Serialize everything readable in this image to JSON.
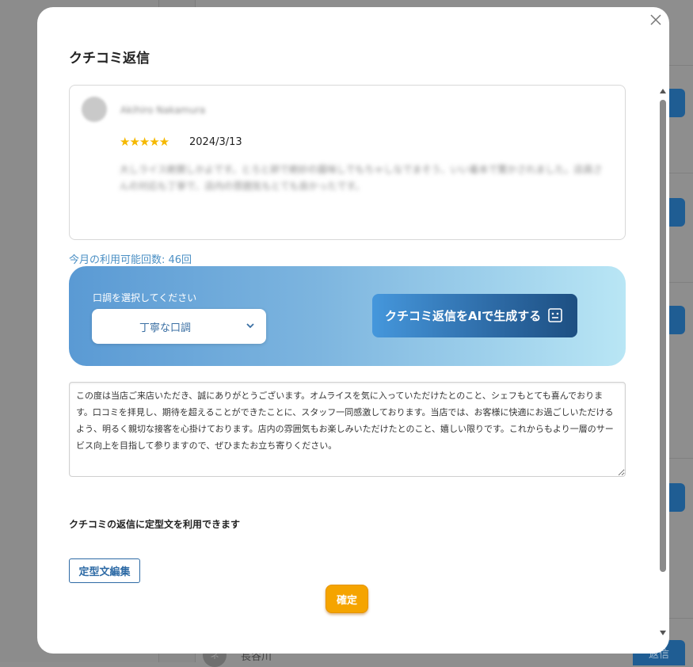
{
  "background": {
    "list_item_name": "長谷川",
    "list_item_avatar": "ネ",
    "reply_button_label": "返信"
  },
  "modal": {
    "title": "クチコミ返信",
    "review": {
      "reviewer_name": "Akihiro Nakamura",
      "stars": "★★★★★",
      "rating": 5,
      "date": "2024/3/13",
      "text": "大しライス絶賛しかよです。とろと卵で絶妙の醤味しでもちゃしなでまそう、いい着本で驚かされました。店員さんの対応も丁寧で、店内の雰囲気もとても良かったです。"
    },
    "usage_text": "今月の利用可能回数: 46回",
    "generator": {
      "tone_label": "口調を選択してください",
      "tone_selected": "丁寧な口調",
      "generate_button_label": "クチコミ返信をAIで生成する",
      "accent_colors": [
        "#5a9ad4",
        "#b9e6f5"
      ]
    },
    "reply_text": "この度は当店ご来店いただき、誠にありがとうございます。オムライスを気に入っていただけたとのこと、シェフもとても喜んでおります。口コミを拝見し、期待を超えることができたことに、スタッフ一同感激しております。当店では、お客様に快適にお過ごしいただけるよう、明るく親切な接客を心掛けております。店内の雰囲気もお楽しみいただけたとのこと、嬉しい限りです。これからもより一層のサービス向上を目指して参りますので、ぜひまたお立ち寄りください。",
    "template_note": "クチコミの返信に定型文を利用できます",
    "template_button_label": "定型文編集",
    "confirm_button_label": "確定",
    "confirm_color": "#f5a400"
  },
  "icons": {
    "close": "close-icon",
    "chevron": "chevron-down-icon",
    "ai": "robot-face-icon"
  }
}
